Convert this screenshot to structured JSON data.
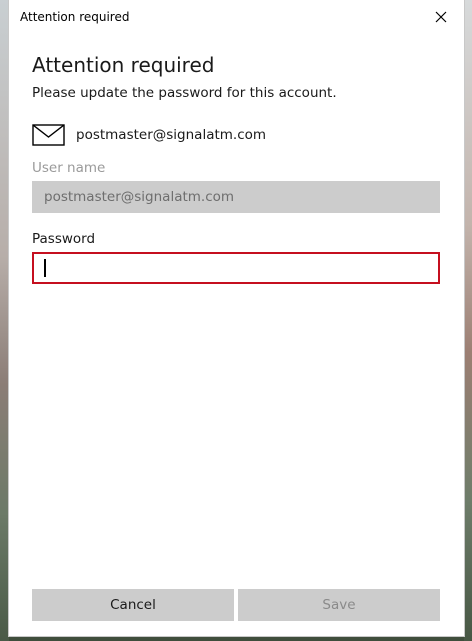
{
  "window": {
    "title": "Attention required"
  },
  "dialog": {
    "heading": "Attention required",
    "message": "Please update the password for this account.",
    "account_email": "postmaster@signalatm.com",
    "account_icon": "mail-icon"
  },
  "fields": {
    "username_label": "User name",
    "username_value": "postmaster@signalatm.com",
    "password_label": "Password",
    "password_value": ""
  },
  "buttons": {
    "cancel_label": "Cancel",
    "save_label": "Save"
  },
  "colors": {
    "error_border": "#c50f1f",
    "disabled_field": "#cccccc",
    "button_bg": "#cccccc"
  }
}
